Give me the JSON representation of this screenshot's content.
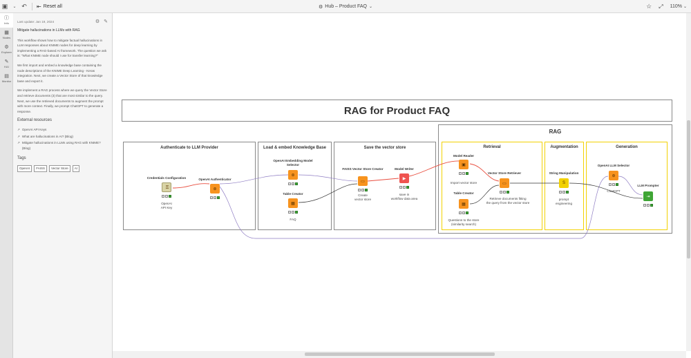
{
  "topbar": {
    "reset_label": "Reset all",
    "workflow_title": "Hub – Product FAQ",
    "zoom": "110%"
  },
  "rail": {
    "items": [
      {
        "label": "Info",
        "icon": "info-icon"
      },
      {
        "label": "Nodes",
        "icon": "nodes-icon"
      },
      {
        "label": "Explorer",
        "icon": "explorer-icon"
      },
      {
        "label": "KAI",
        "icon": "kai-icon"
      },
      {
        "label": "Monitor",
        "icon": "monitor-icon"
      }
    ]
  },
  "description": {
    "last_update": "Last update: Jan 19, 2024",
    "heading": "Mitigate hallucinations in LLMs with RAG",
    "paragraphs": [
      "This workflow shows how to mitigate factual hallucinations in LLM responses about KNIME nodes for deep learning by implementing a RAG-based AI framework. The question we ask is: \"What KNIME node should I use for transfer learning?\"",
      "We first import and embed a knowledge base containing the node descriptions of the KNIME Deep Learning - Keras integration. Next, we create a Vector Store of that knowledge base and export it.",
      "We implement a RAG process where we query the Vector Store and retrieve documents (3) that are most similar to the query. Next, we use the retrieved documents to augment the prompt with more context. Finally, we prompt ChatGPT to generate a response."
    ],
    "resources_title": "External resources",
    "resources": [
      "OpenAI API Keys",
      "What are hallucinations in AI? (Blog)",
      "Mitigate hallucinations in LLMs using RAG with KNIME? (Blog)"
    ],
    "tags_title": "Tags",
    "tags": [
      "OpenAI",
      "FAISS",
      "Vector Store",
      "AI"
    ]
  },
  "canvas": {
    "main_title": "RAG for Product FAQ",
    "sections": {
      "auth": "Authenticate to LLM Provider",
      "load": "Load & embed Knowledge Base",
      "save": "Save the vector store",
      "rag": "RAG",
      "retrieval": "Retrieval",
      "augmentation": "Augmentation",
      "generation": "Generation"
    },
    "nodes": {
      "cred": {
        "label": "Credentials Configuration",
        "desc": "OpenAI\nAPI Key"
      },
      "auth": {
        "label": "OpenAI Authenticator",
        "desc": ""
      },
      "embed": {
        "label": "OpenAI Embedding Model\nSelector",
        "desc": ""
      },
      "table1": {
        "label": "Table Creator",
        "desc": "FAQ"
      },
      "faiss": {
        "label": "FAISS Vector Store Creator",
        "desc": "Create\nvector store"
      },
      "writer": {
        "label": "Model Writer",
        "desc": "save in\nworkflow data area"
      },
      "reader": {
        "label": "Model Reader",
        "desc": "Import vector store"
      },
      "table2": {
        "label": "Table Creator",
        "desc": "Questions to the store\n(similarity search)"
      },
      "retriever": {
        "label": "Vector Store Retriever",
        "desc": "Retrieve documents fitting\nthe query from the vector store"
      },
      "strman": {
        "label": "String Manipulation",
        "desc": "prompt\nengineering"
      },
      "llmsel": {
        "label": "OpenAI LLM Selector",
        "desc": "ChatGPT"
      },
      "prompter": {
        "label": "LLM Prompter",
        "desc": ""
      }
    }
  },
  "colors": {
    "node_orange": "#f7931e",
    "node_red": "#ef5350",
    "node_green": "#3fa535",
    "node_beige": "#d9d4a6",
    "annotation_yellow": "#f2d100",
    "wire_red": "#e84c3d",
    "wire_purple": "#8e7cc3"
  }
}
